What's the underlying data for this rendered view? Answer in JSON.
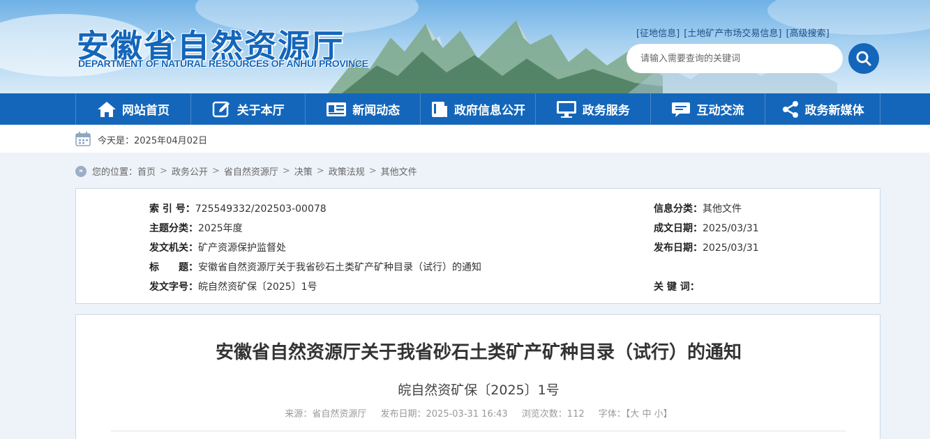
{
  "header": {
    "logo_cn": "安徽省自然资源厅",
    "logo_en": "DEPARTMENT OF NATURAL RESOURCES OF ANHUI PROVINCE",
    "top_links": [
      "[征地信息]",
      "[土地矿产市场交易信息]",
      "[高级搜索]"
    ],
    "search_placeholder": "请输入需要查询的关键词"
  },
  "nav": [
    {
      "label": "网站首页",
      "icon": "home-icon"
    },
    {
      "label": "关于本厅",
      "icon": "edit-icon"
    },
    {
      "label": "新闻动态",
      "icon": "news-icon"
    },
    {
      "label": "政府信息公开",
      "icon": "book-icon"
    },
    {
      "label": "政务服务",
      "icon": "monitor-icon"
    },
    {
      "label": "互动交流",
      "icon": "chat-icon"
    },
    {
      "label": "政务新媒体",
      "icon": "share-icon"
    }
  ],
  "datebar": {
    "text": "今天是：2025年04月02日"
  },
  "breadcrumb": {
    "prefix": "您的位置：",
    "items": [
      "首页",
      "政务公开",
      "省自然资源厅",
      "决策",
      "政策法规",
      "其他文件"
    ]
  },
  "info": {
    "left": [
      {
        "label": "索 引 号：",
        "value": "725549332/202503-00078"
      },
      {
        "label": "主题分类：",
        "value": "2025年度"
      },
      {
        "label": "发文机关：",
        "value": "矿产资源保护监督处"
      },
      {
        "label": "标　　题：",
        "value": "安徽省自然资源厅关于我省砂石土类矿产矿种目录（试行）的通知"
      },
      {
        "label": "发文字号：",
        "value": "皖自然资矿保〔2025〕1号"
      }
    ],
    "right": [
      {
        "label": "信息分类：",
        "value": "其他文件"
      },
      {
        "label": "成文日期：",
        "value": "2025/03/31"
      },
      {
        "label": "发布日期：",
        "value": "2025/03/31"
      },
      {
        "label": "关 键 词：",
        "value": ""
      }
    ]
  },
  "article": {
    "title": "安徽省自然资源厅关于我省砂石土类矿产矿种目录（试行）的通知",
    "doc_no": "皖自然资矿保〔2025〕1号",
    "source": "来源：省自然资源厅",
    "pub_date": "发布日期：2025-03-31 16:43",
    "views": "浏览次数：112",
    "font_label": "字体：",
    "font_open": "【",
    "font_large": "大",
    "font_medium": "中",
    "font_small": "小",
    "font_close": "】"
  },
  "colors": {
    "brand_blue": "#1466ba",
    "nav_divider": "#4a88c8"
  }
}
